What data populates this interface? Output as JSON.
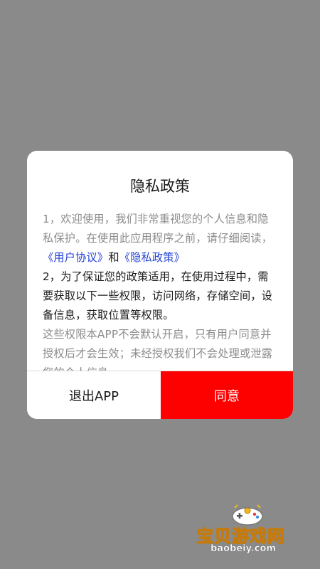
{
  "dialog": {
    "title": "隐私政策",
    "paragraph1_text": "1，欢迎使用，我们非常重视您的个人信息和隐私保护。在使用此应用程序之前，请仔细阅读，",
    "user_agreement_link": "《用户协议》",
    "and_text": "和",
    "privacy_policy_link": "《隐私政策》",
    "paragraph2": "2，为了保证您的政策适用，在使用过程中，需要获取以下一些权限，访问网络，存储空间，设备信息，获取位置等权限。",
    "paragraph3": "这些权限本APP不会默认开启，只有用户同意并授权后才会生效；未经授权我们不会处理或泄露您的个人信息。",
    "exit_label": "退出APP",
    "agree_label": "同意"
  },
  "watermark": {
    "brand": "宝贝游戏网",
    "url": "baobeiy.com",
    "logo_icon": "gamepad-icon"
  },
  "colors": {
    "overlay": "#8a8a8a",
    "agree_button": "#fd0000",
    "link": "#2342d6",
    "watermark": "#f2b71c"
  }
}
